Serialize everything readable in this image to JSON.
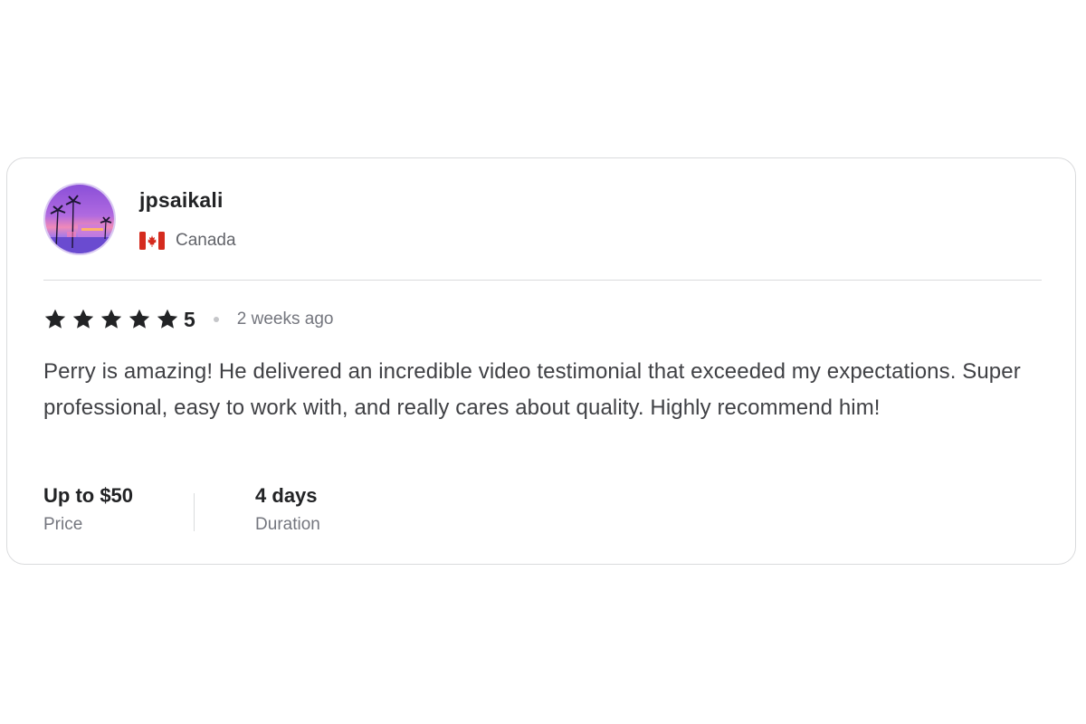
{
  "review": {
    "username": "jpsaikali",
    "avatar_icon": "avatar-palm-trees-sunset",
    "country": "Canada",
    "country_flag_icon": "canada-flag-icon",
    "rating": {
      "stars": 5,
      "max_stars": 5,
      "value_label": "5",
      "star_color": "#222325"
    },
    "time_ago": "2 weeks ago",
    "text": "Perry is amazing! He delivered an incredible video testimonial that exceeded my expectations. Super professional, easy to work with, and really cares about quality. Highly recommend him!",
    "price": {
      "value": "Up to $50",
      "label": "Price"
    },
    "duration": {
      "value": "4 days",
      "label": "Duration"
    }
  },
  "colors": {
    "card_border": "#dadbdd",
    "text_primary": "#222325",
    "text_secondary": "#62646a",
    "flag_red": "#d52b1e"
  }
}
